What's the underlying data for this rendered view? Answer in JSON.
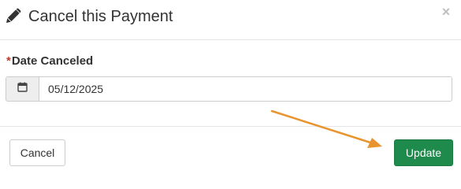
{
  "dialog": {
    "title": "Cancel this Payment",
    "title_icon": "pencil-icon",
    "close_label": "×"
  },
  "form": {
    "date_field": {
      "required_marker": "*",
      "label": "Date Canceled",
      "value": "05/12/2025",
      "addon_icon": "calendar-icon"
    }
  },
  "footer": {
    "cancel_label": "Cancel",
    "update_label": "Update"
  },
  "annotation": {
    "type": "arrow",
    "color": "#e8952f",
    "points_to": "update-button"
  },
  "colors": {
    "primary_button": "#1e8a4c",
    "required": "#c0392b"
  }
}
